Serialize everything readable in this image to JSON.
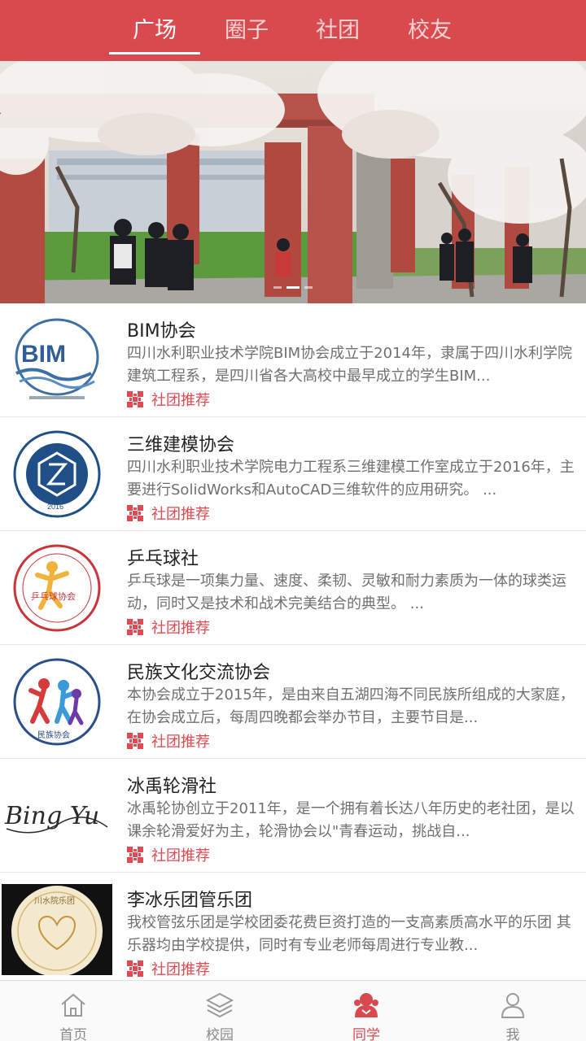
{
  "tabs": [
    {
      "label": "广场",
      "active": true
    },
    {
      "label": "圈子",
      "active": false
    },
    {
      "label": "社团",
      "active": false
    },
    {
      "label": "校友",
      "active": false
    }
  ],
  "banner": {
    "slide_count": 3,
    "active_slide": 1,
    "image": "campus-cherry-blossom-photo"
  },
  "clubs": [
    {
      "name": "BIM协会",
      "description": "四川水利职业技术学院BIM协会成立于2014年，隶属于四川水利学院建筑工程系，是四川省各大高校中最早成立的学生BIM...",
      "tag": "社团推荐",
      "logo_text": "BIM"
    },
    {
      "name": "三维建模协会",
      "description": "四川水利职业技术学院电力工程系三维建模工作室成立于2016年，主要进行SolidWorks和AutoCAD三维软件的应用研究。 ...",
      "tag": "社团推荐",
      "logo_text": "2016"
    },
    {
      "name": "乒乓球社",
      "description": "乒乓球是一项集力量、速度、柔韧、灵敏和耐力素质为一体的球类运动，同时又是技术和战术完美结合的典型。 ...",
      "tag": "社团推荐",
      "logo_text": "乒乓球协会"
    },
    {
      "name": "民族文化交流协会",
      "description": "本协会成立于2015年，是由来自五湖四海不同民族所组成的大家庭，在协会成立后，每周四晚都会举办节目，主要节目是...",
      "tag": "社团推荐",
      "logo_text": "民族协会"
    },
    {
      "name": "冰禹轮滑社",
      "description": "冰禹轮协创立于2011年，是一个拥有着长达八年历史的老社团，是以课余轮滑爱好为主，轮滑协会以\"青春运动，挑战自...",
      "tag": "社团推荐",
      "logo_text": "Bing Yu"
    },
    {
      "name": "李冰乐团管乐团",
      "description": "我校管弦乐团是学校团委花费巨资打造的一支高素质高水平的乐团 其乐器均由学校提供，同时有专业老师每周进行专业教...",
      "tag": "社团推荐",
      "logo_text": "川水院乐团"
    }
  ],
  "bottom_nav": [
    {
      "label": "首页",
      "icon": "home-icon",
      "active": false
    },
    {
      "label": "校园",
      "icon": "layers-icon",
      "active": false
    },
    {
      "label": "同学",
      "icon": "classmates-icon",
      "active": true
    },
    {
      "label": "我",
      "icon": "person-icon",
      "active": false
    }
  ],
  "colors": {
    "brand": "#d94a4f",
    "tag": "#e04a52",
    "title_text": "#222222",
    "desc_text": "#707070"
  }
}
